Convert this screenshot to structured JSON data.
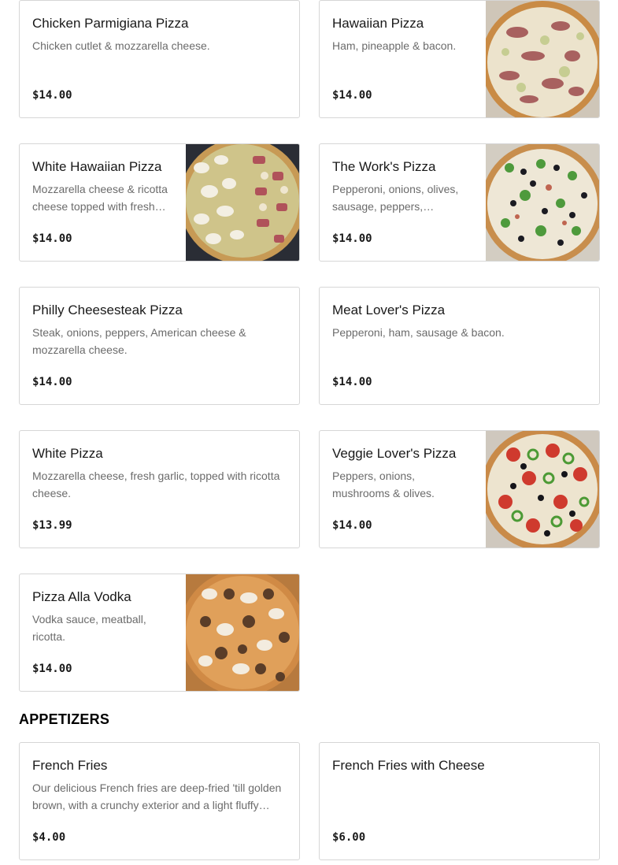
{
  "menu": {
    "items": [
      {
        "name": "Chicken Parmigiana Pizza",
        "description": "Chicken cutlet & mozzarella cheese.",
        "price": "$14.00",
        "image": "none"
      },
      {
        "name": "Hawaiian Pizza",
        "description": "Ham, pineapple & bacon.",
        "price": "$14.00",
        "image": "hawaiian-pizza-photo"
      },
      {
        "name": "White Hawaiian Pizza",
        "description": "Mozzarella cheese & ricotta cheese topped with fresh pineapple, ham & bacon.",
        "price": "$14.00",
        "image": "white-hawaiian-pizza-photo"
      },
      {
        "name": "The Work's Pizza",
        "description": "Pepperoni, onions, olives, sausage, peppers, mushrooms & extra cheese.",
        "price": "$14.00",
        "image": "works-pizza-photo"
      },
      {
        "name": "Philly Cheesesteak Pizza",
        "description": "Steak, onions, peppers, American cheese & mozzarella cheese.",
        "price": "$14.00",
        "image": "none"
      },
      {
        "name": "Meat Lover's Pizza",
        "description": "Pepperoni, ham, sausage & bacon.",
        "price": "$14.00",
        "image": "none"
      },
      {
        "name": "White Pizza",
        "description": "Mozzarella cheese, fresh garlic, topped with ricotta cheese.",
        "price": "$13.99",
        "image": "none"
      },
      {
        "name": "Veggie Lover's Pizza",
        "description": "Peppers, onions, mushrooms & olives.",
        "price": "$14.00",
        "image": "veggie-pizza-photo"
      },
      {
        "name": "Pizza Alla Vodka",
        "description": "Vodka sauce, meatball, ricotta.",
        "price": "$14.00",
        "image": "vodka-pizza-photo"
      }
    ]
  },
  "appetizers": {
    "title": "APPETIZERS",
    "items": [
      {
        "name": "French Fries",
        "description": "Our delicious French fries are deep-fried 'till golden brown, with a crunchy exterior and a light fluffy interior.",
        "price": "$4.00"
      },
      {
        "name": "French Fries with Cheese",
        "description": "",
        "price": "$6.00"
      }
    ]
  }
}
